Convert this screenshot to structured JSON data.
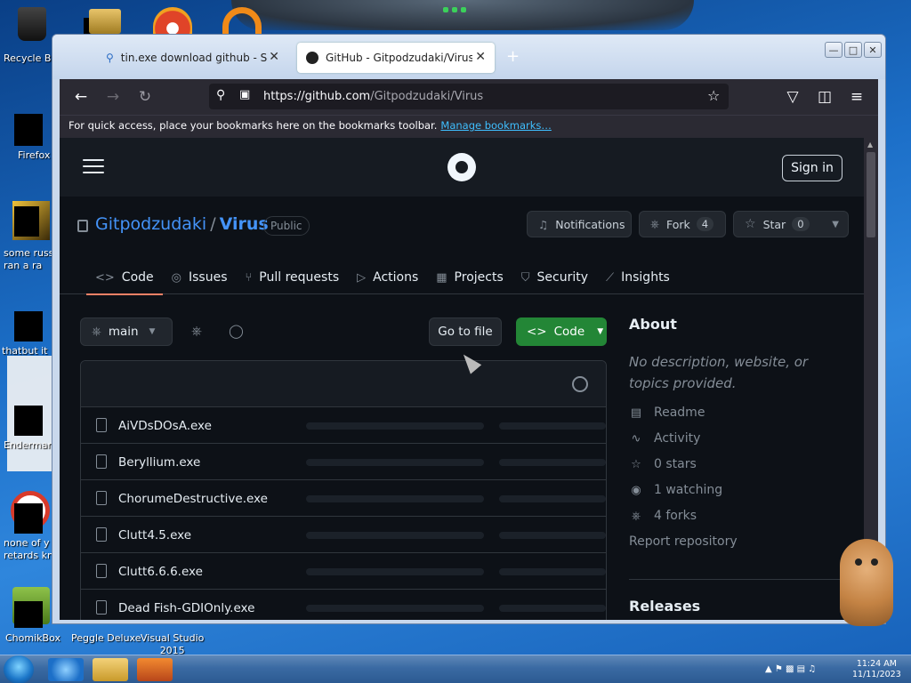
{
  "desktop": {
    "icons": [
      {
        "label": "Recycle Bin"
      },
      {
        "label": "Firefox"
      },
      {
        "label": "some russ\nran a ra"
      },
      {
        "label": "thatbut it"
      },
      {
        "label": "Enderman"
      },
      {
        "label": "none of y\nretards kn"
      },
      {
        "label": "ChomikBox"
      },
      {
        "label": "Peggle Deluxe"
      },
      {
        "label": "Visual Studio\n2015"
      }
    ]
  },
  "firefox": {
    "tabs": [
      {
        "title": "tin.exe download github - Search"
      },
      {
        "title": "GitHub - Gitpodzudaki/Virus"
      }
    ],
    "url_host": "https://github.com",
    "url_path": "/Gitpodzudaki/Virus",
    "bookmarks_text": "For quick access, place your bookmarks here on the bookmarks toolbar.",
    "bookmarks_link": "Manage bookmarks…"
  },
  "github": {
    "sign_in": "Sign in",
    "owner": "Gitpodzudaki",
    "separator": "/",
    "repo": "Virus",
    "visibility": "Public",
    "notifications": "Notifications",
    "fork_label": "Fork",
    "fork_count": "4",
    "star_label": "Star",
    "star_count": "0",
    "tabs": [
      {
        "label": "Code",
        "icon": "<>"
      },
      {
        "label": "Issues",
        "icon": "◎"
      },
      {
        "label": "Pull requests",
        "icon": "⑂"
      },
      {
        "label": "Actions",
        "icon": "▷"
      },
      {
        "label": "Projects",
        "icon": "▦"
      },
      {
        "label": "Security",
        "icon": "⛉"
      },
      {
        "label": "Insights",
        "icon": "⟋"
      }
    ],
    "branch": "main",
    "go_to_file": "Go to file",
    "code_button": "Code",
    "files": [
      {
        "name": "AiVDsDOsA.exe"
      },
      {
        "name": "Beryllium.exe"
      },
      {
        "name": "ChorumeDestructive.exe"
      },
      {
        "name": "Clutt4.5.exe"
      },
      {
        "name": "Clutt6.6.6.exe"
      },
      {
        "name": "Dead Fish-GDIOnly.exe"
      }
    ],
    "about": {
      "title": "About",
      "description": "No description, website, or topics provided.",
      "items": [
        {
          "icon": "book-icon",
          "label": "Readme"
        },
        {
          "icon": "pulse-icon",
          "label": "Activity"
        },
        {
          "icon": "star-icon",
          "label": "0 stars"
        },
        {
          "icon": "eye-icon",
          "label": "1 watching"
        },
        {
          "icon": "fork-icon",
          "label": "4 forks"
        }
      ],
      "report": "Report repository",
      "releases": "Releases"
    }
  },
  "taskbar": {
    "time": "11:24 AM",
    "date": "11/11/2023"
  }
}
